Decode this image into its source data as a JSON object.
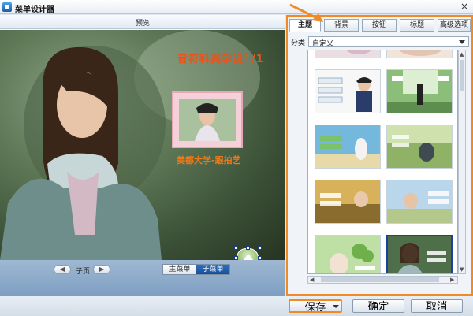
{
  "window": {
    "title": "菜单设计器",
    "close_glyph": "×"
  },
  "preview": {
    "title": "预览",
    "headline": "音符科美学设1/1",
    "caption": "美都大学-跟拍艺",
    "pager": {
      "prev_glyph": "◀",
      "label": "子页",
      "next_glyph": "▶"
    },
    "menu_switch": {
      "main": "主菜单",
      "sub": "子菜单",
      "selected": "子菜单"
    }
  },
  "tabs": [
    {
      "label": "主题",
      "active": true
    },
    {
      "label": "背景",
      "active": false
    },
    {
      "label": "按钮",
      "active": false
    },
    {
      "label": "标题",
      "active": false
    },
    {
      "label": "高级选项",
      "active": false
    }
  ],
  "category": {
    "label": "分类",
    "value": "自定义"
  },
  "gallery": {
    "items": [
      {
        "name": "partial-top-left",
        "bg": "#e9dfe3"
      },
      {
        "name": "partial-top-right",
        "bg": "#f1e4da"
      },
      {
        "name": "theme-boy-white",
        "bg": "#f7f7f7"
      },
      {
        "name": "theme-green-stage",
        "bg": "#8bbf79"
      },
      {
        "name": "theme-beach-blue",
        "bg": "#74b8de"
      },
      {
        "name": "theme-field-green",
        "bg": "#8fb267"
      },
      {
        "name": "theme-sunset-yellow",
        "bg": "#d7b25a"
      },
      {
        "name": "theme-sky-blue",
        "bg": "#b9d6ea"
      },
      {
        "name": "theme-clover",
        "bg": "#bfe0a4"
      },
      {
        "name": "theme-woman-selected",
        "bg": "#4f6f4a"
      }
    ],
    "selected_index": 9
  },
  "buttons": {
    "save": "保存",
    "ok": "确定",
    "cancel": "取消"
  },
  "colors": {
    "highlight": "#f08a24",
    "accent": "#1b4f94"
  }
}
